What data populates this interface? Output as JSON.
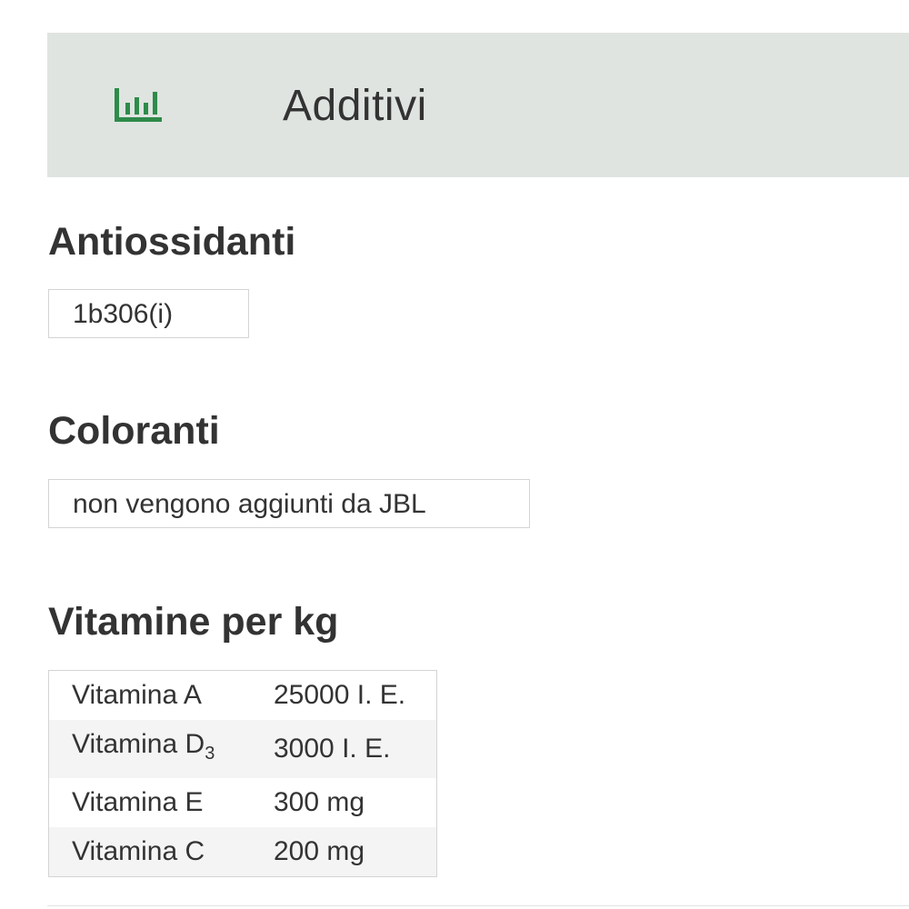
{
  "header": {
    "icon": "bar-chart-icon",
    "title": "Additivi",
    "accent_color": "#2e8b4a",
    "background_color": "#dfe4e0"
  },
  "sections": {
    "antioxidants": {
      "title": "Antiossidanti",
      "value": "1b306(i)"
    },
    "colorants": {
      "title": "Coloranti",
      "value": "non vengono aggiunti da JBL"
    },
    "vitamins": {
      "title": "Vitamine per kg",
      "rows": [
        {
          "name": "Vitamina A",
          "value": "25000 I. E."
        },
        {
          "name": "Vitamina D",
          "subscript": "3",
          "value": "3000 I. E."
        },
        {
          "name": "Vitamina E",
          "value": "300 mg"
        },
        {
          "name": "Vitamina C",
          "value": "200 mg"
        }
      ]
    }
  }
}
